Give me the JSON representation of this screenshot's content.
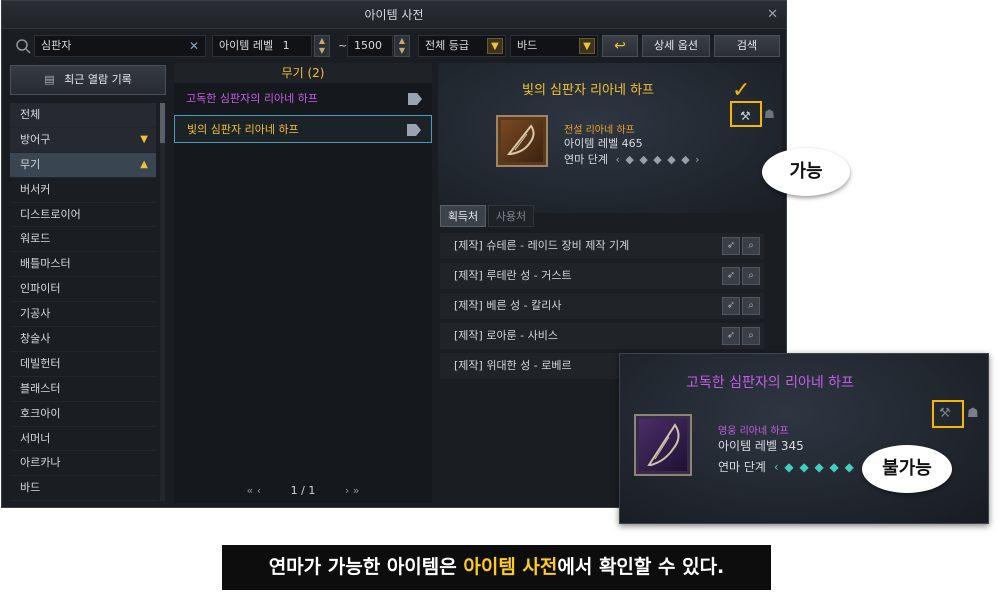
{
  "window": {
    "title": "아이템 사전",
    "close_icon": "close-icon"
  },
  "search": {
    "query": "심판자",
    "level_label": "아이템 레벨",
    "level_min": "1",
    "tilde": "~",
    "level_max": "1500",
    "grade": "전체 등급",
    "class": "바드",
    "advanced_label": "상세 옵션",
    "search_label": "검색"
  },
  "sidebar": {
    "recent_label": "최근 열람 기록",
    "items": [
      {
        "label": "전체"
      },
      {
        "label": "방어구"
      },
      {
        "label": "무기"
      },
      {
        "label": "버서커"
      },
      {
        "label": "디스트로이어"
      },
      {
        "label": "워로드"
      },
      {
        "label": "배틀마스터"
      },
      {
        "label": "인파이터"
      },
      {
        "label": "기공사"
      },
      {
        "label": "창술사"
      },
      {
        "label": "데빌헌터"
      },
      {
        "label": "블래스터"
      },
      {
        "label": "호크아이"
      },
      {
        "label": "서머너"
      },
      {
        "label": "아르카나"
      },
      {
        "label": "바드"
      }
    ]
  },
  "results": {
    "header": "무기 (2)",
    "items": [
      {
        "name": "고독한 심판자의 리아네 하프"
      },
      {
        "name": "빛의 심판자 리아네 하프"
      }
    ],
    "pager": "1 / 1"
  },
  "detail": {
    "name": "빛의 심판자 리아네 하프",
    "grade_type": "전설 리아네 하프",
    "level": "아이템 레벨 465",
    "refine_label": "연마 단계"
  },
  "tabs": [
    {
      "label": "획득처"
    },
    {
      "label": "사용처"
    }
  ],
  "sources": [
    {
      "label": "[제작] 슈테른 - 레이드 장비 제작 기계"
    },
    {
      "label": "[제작] 루테란 성 - 거스트"
    },
    {
      "label": "[제작] 베른 성 - 칼리사"
    },
    {
      "label": "[제작] 로아룬 - 사비스"
    },
    {
      "label": "[제작] 위대한 성 - 로베르"
    }
  ],
  "popup": {
    "name": "고독한 심판자의 리아네 하프",
    "grade_type": "영웅 리아네 하프",
    "level": "아이템 레벨 345",
    "refine_label": "연마 단계"
  },
  "callouts": {
    "possible": "가능",
    "impossible": "불가능"
  },
  "caption": {
    "part1": "연마가 가능한 아이템은 ",
    "highlight": "아이템 사전",
    "part2": "에서 확인할 수 있다."
  },
  "colors": {
    "legend": "#f1c232",
    "epic": "#c45ee6",
    "accent_yellow": "#f5b800"
  }
}
